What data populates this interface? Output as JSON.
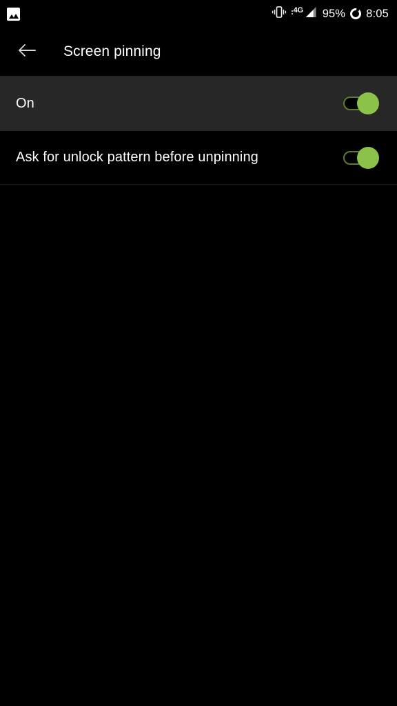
{
  "status_bar": {
    "notification_icon": "gallery-icon",
    "vibrate_icon": "vibrate-icon",
    "network_type": "4G",
    "signal_icon": "signal-bars-icon",
    "battery_percent": "95%",
    "battery_icon": "battery-ring-icon",
    "time": "8:05"
  },
  "toolbar": {
    "back_icon": "arrow-left-icon",
    "title": "Screen pinning"
  },
  "settings": {
    "rows": [
      {
        "label": "On",
        "switch_state": "on",
        "highlighted": true
      },
      {
        "label": "Ask for unlock pattern before unpinning",
        "switch_state": "on",
        "highlighted": false
      }
    ]
  },
  "colors": {
    "background": "#000000",
    "highlight_row": "#272727",
    "switch_thumb_on": "#8BC34A",
    "switch_track_on": "#5d7d2a",
    "text_primary": "#ffffff",
    "divider": "#1b1b1b"
  }
}
